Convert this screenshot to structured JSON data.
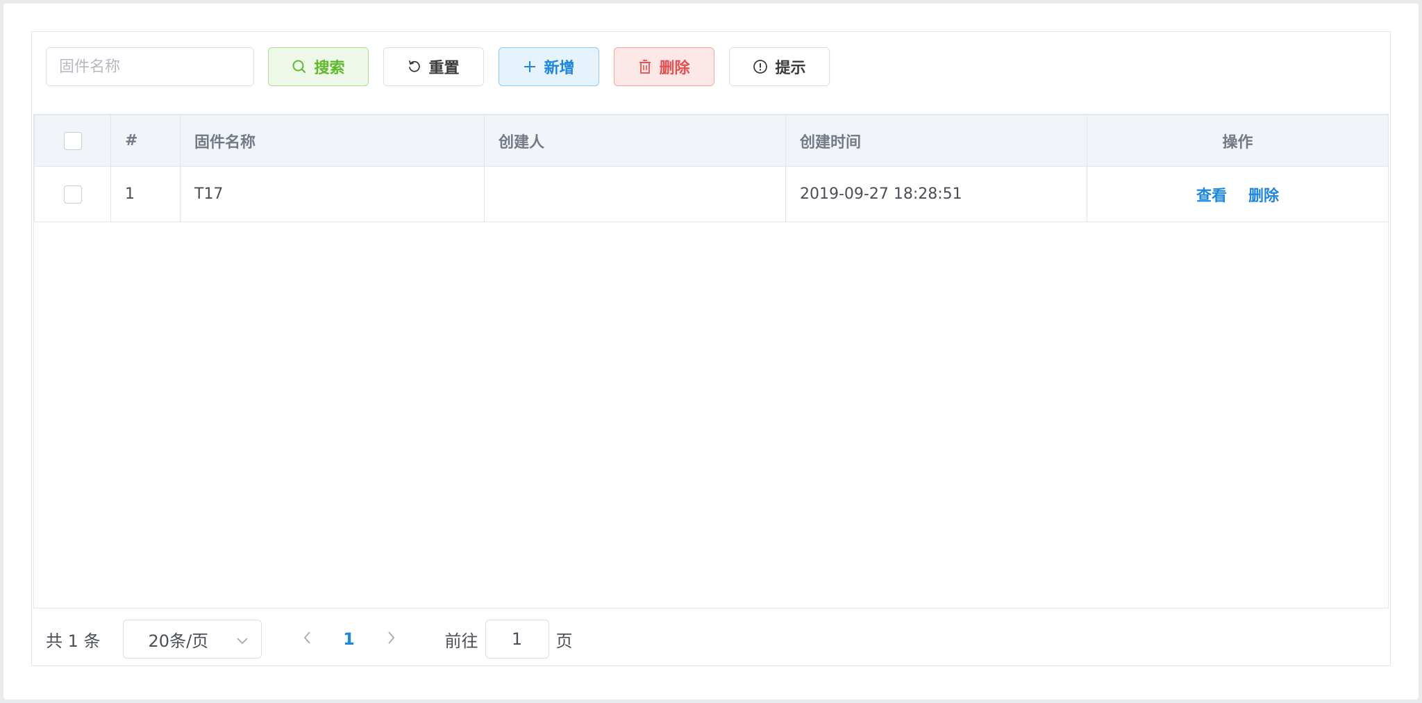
{
  "toolbar": {
    "search_placeholder": "固件名称",
    "search_label": "搜索",
    "reset_label": "重置",
    "add_label": "新增",
    "delete_label": "删除",
    "tip_label": "提示"
  },
  "colors": {
    "primary": "#1d86e0",
    "success": "#5cba2c",
    "danger": "#ec4c4c"
  },
  "table": {
    "columns": {
      "index": "#",
      "name": "固件名称",
      "creator": "创建人",
      "created_at": "创建时间",
      "actions": "操作"
    },
    "rows": [
      {
        "index": "1",
        "name": "T17",
        "creator": "",
        "created_at": "2019-09-27 18:28:51",
        "view_label": "查看",
        "delete_label": "删除"
      }
    ]
  },
  "pagination": {
    "total_text": "共 1 条",
    "page_size": "20条/页",
    "current_page": "1",
    "goto_label": "前往",
    "goto_value": "1",
    "page_suffix": "页"
  }
}
